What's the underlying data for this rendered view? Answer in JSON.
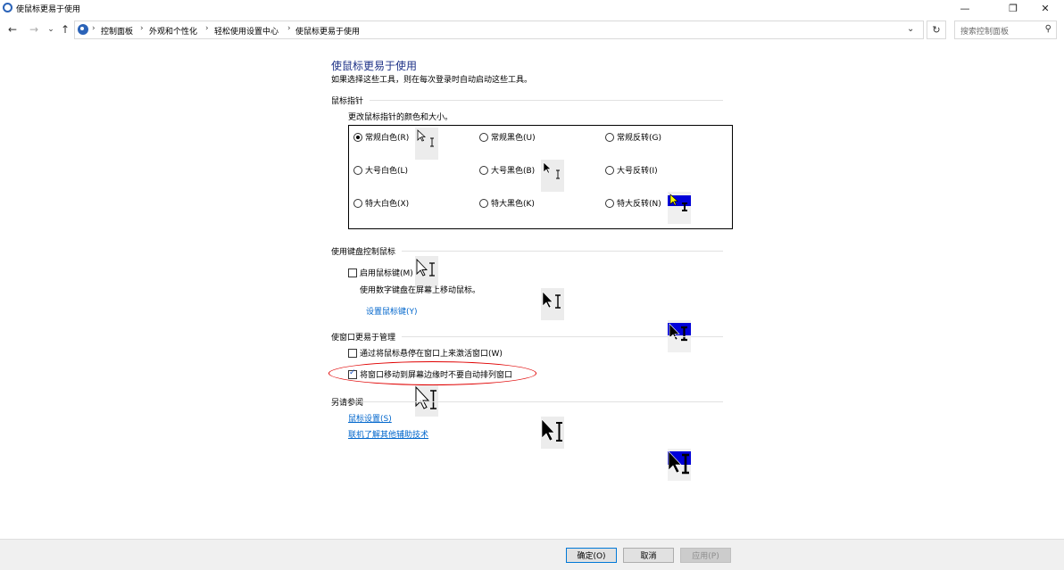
{
  "window": {
    "title": "使鼠标更易于使用",
    "controls": {
      "minimize": "—",
      "restore": "❐",
      "close": "✕"
    }
  },
  "nav": {
    "back": "←",
    "forward": "→",
    "recent": "⌄",
    "up": "↑",
    "breadcrumbs": [
      "控制面板",
      "外观和个性化",
      "轻松使用设置中心",
      "使鼠标更易于使用"
    ],
    "separator": "›",
    "dropdown": "⌄",
    "refresh": "↻",
    "search_placeholder": "搜索控制面板",
    "search_icon": "⚲"
  },
  "main": {
    "title": "使鼠标更易于使用",
    "subtitle": "如果选择这些工具，则在每次登录时自动启动这些工具。",
    "pointer": {
      "section": "鼠标指针",
      "desc": "更改鼠标指针的颜色和大小。",
      "schemes": [
        {
          "label": "常规白色(R)",
          "selected": true
        },
        {
          "label": "常规黑色(U)",
          "selected": false
        },
        {
          "label": "常规反转(G)",
          "selected": false
        },
        {
          "label": "大号白色(L)",
          "selected": false
        },
        {
          "label": "大号黑色(B)",
          "selected": false
        },
        {
          "label": "大号反转(I)",
          "selected": false
        },
        {
          "label": "特大白色(X)",
          "selected": false
        },
        {
          "label": "特大黑色(K)",
          "selected": false
        },
        {
          "label": "特大反转(N)",
          "selected": false
        }
      ]
    },
    "keyboard": {
      "section": "使用键盘控制鼠标",
      "mousekeys_label": "启用鼠标键(M)",
      "mousekeys_checked": false,
      "mousekeys_desc": "使用数字键盘在屏幕上移动鼠标。",
      "setup_link": "设置鼠标键(Y)"
    },
    "windows": {
      "section": "使窗口更易于管理",
      "hover_activate_label": "通过将鼠标悬停在窗口上来激活窗口(W)",
      "hover_activate_checked": false,
      "prevent_arrange_label": "将窗口移动到屏幕边缘时不要自动排列窗口",
      "prevent_arrange_checked": true
    },
    "see_also": {
      "section": "另请参阅",
      "links": [
        "鼠标设置(S)",
        "联机了解其他辅助技术"
      ]
    }
  },
  "footer": {
    "ok": "确定(O)",
    "cancel": "取消",
    "apply": "应用(P)"
  },
  "colors": {
    "title_blue": "#1e3287",
    "link_blue": "#0066cc",
    "highlight_red": "#e00000",
    "invert_blue": "#0000d8"
  }
}
